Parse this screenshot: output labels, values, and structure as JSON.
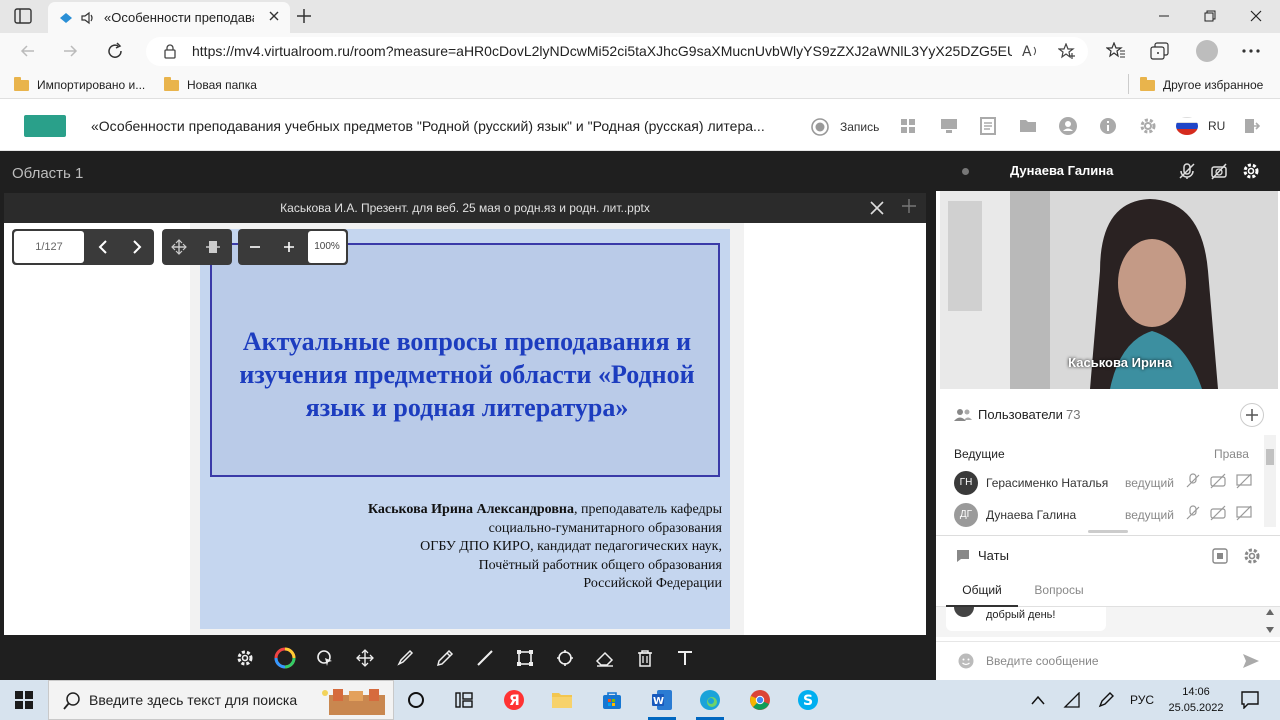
{
  "browser": {
    "tab_title": "«Особенности преподава",
    "url": "https://mv4.virtualroom.ru/room?measure=aHR0cDovL2lyNDcwMi52ci5taXJhcG9saXMucnUvbWlyYS9zZXJ2aWNlL3YyX25DZG5EU...",
    "bookmarks": [
      {
        "label": "Импортировано и..."
      },
      {
        "label": "Новая папка"
      }
    ],
    "other_favorites": "Другое избранное"
  },
  "app": {
    "title": "«Особенности преподавания учебных предметов \"Родной (русский) язык\" и \"Родная (русская) литера...",
    "record_label": "Запись",
    "language": "RU"
  },
  "stage": {
    "area_title": "Область 1",
    "presentation_name": "Каськова И.А. Презент. для веб. 25 мая о родн.яз и родн. лит..pptx",
    "page_indicator": "1/127",
    "zoom": "100%"
  },
  "slide": {
    "title_lines": [
      "Актуальные вопросы преподавания и",
      "изучения предметной области «Родной",
      "язык и родная литература»"
    ],
    "author_name": "Каськова Ирина Александровна",
    "author_lines": [
      ", преподаватель кафедры",
      "социально-гуманитарного образования",
      "ОГБУ ДПО КИРО, кандидат педагогических наук,",
      "Почётный работник общего образования",
      "Российской Федерации"
    ]
  },
  "video": {
    "header_name": "Дунаева Галина",
    "speaker_label": "Каськова Ирина"
  },
  "users": {
    "title": "Пользователи",
    "count": "73",
    "section": "Ведущие",
    "rights_label": "Права",
    "rows": [
      {
        "initials": "ГН",
        "name": "Герасименко Наталья",
        "role": "ведущий",
        "color": "#3a3a3a"
      },
      {
        "initials": "ДГ",
        "name": "Дунаева Галина",
        "role": "ведущий",
        "color": "#9a9a9a"
      }
    ]
  },
  "chats": {
    "title": "Чаты",
    "tabs": [
      "Общий",
      "Вопросы"
    ],
    "message_preview": "добрый день!",
    "input_placeholder": "Введите сообщение"
  },
  "taskbar": {
    "search_placeholder": "Введите здесь текст для поиска",
    "lang": "РУС",
    "time": "14:06",
    "date": "25.05.2022"
  },
  "colors": {
    "slide_bg": "#c5d6ef",
    "slide_title": "#1d3dbf",
    "stage_bg": "#1f1f1f"
  }
}
